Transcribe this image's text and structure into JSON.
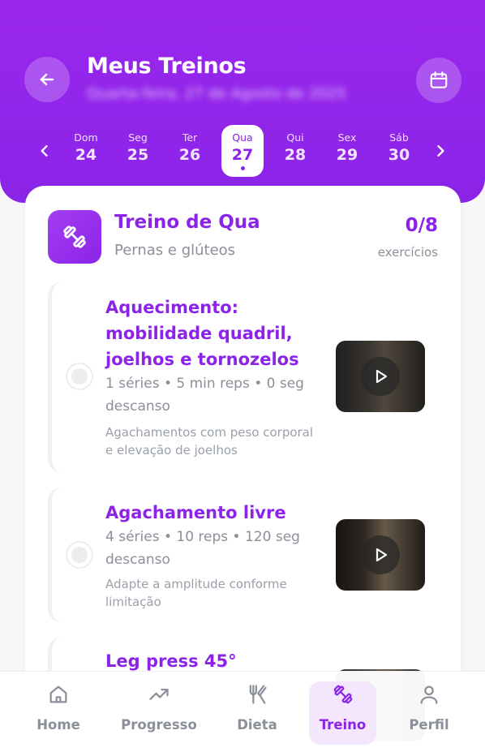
{
  "header": {
    "title": "Meus Treinos",
    "subtitle": "Quarta-feira, 27 de Agosto de 2025"
  },
  "week": {
    "days": [
      {
        "name": "Dom",
        "num": "24"
      },
      {
        "name": "Seg",
        "num": "25"
      },
      {
        "name": "Ter",
        "num": "26"
      },
      {
        "name": "Qua",
        "num": "27"
      },
      {
        "name": "Qui",
        "num": "28"
      },
      {
        "name": "Sex",
        "num": "29"
      },
      {
        "name": "Sáb",
        "num": "30"
      }
    ],
    "selected_index": 3
  },
  "workout": {
    "title": "Treino de Qua",
    "subtitle": "Pernas e glúteos",
    "count": "0/8",
    "count_label": "exercícios"
  },
  "exercises": [
    {
      "name": "Aquecimento: mobilidade quadril, joelhos e tornozelos",
      "meta": "1 séries • 5 min reps • 0 seg descanso",
      "note": "Agachamentos com peso corporal e elevação de joelhos"
    },
    {
      "name": "Agachamento livre",
      "meta": "4 séries • 10 reps • 120 seg descanso",
      "note": "Adapte a amplitude conforme limitação"
    },
    {
      "name": "Leg press 45°",
      "meta": "",
      "note": ""
    }
  ],
  "nav": {
    "items": [
      {
        "label": "Home",
        "icon": "home-icon"
      },
      {
        "label": "Progresso",
        "icon": "trending-up-icon"
      },
      {
        "label": "Dieta",
        "icon": "utensils-icon"
      },
      {
        "label": "Treino",
        "icon": "dumbbell-icon"
      },
      {
        "label": "Perfil",
        "icon": "user-icon"
      }
    ],
    "active": "Treino"
  },
  "colors": {
    "primary": "#8b24e8",
    "muted_text": "#8a8f99",
    "background": "#f7f7f9"
  }
}
